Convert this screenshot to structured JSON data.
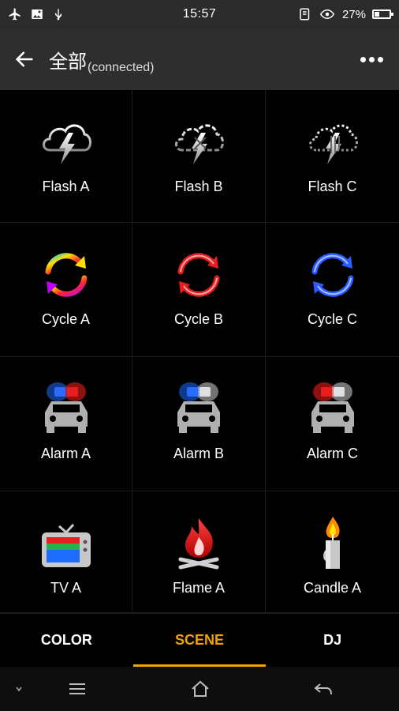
{
  "status": {
    "time": "15:57",
    "battery": "27%",
    "left_icons": [
      "airplane-icon",
      "image-icon",
      "usb-icon"
    ],
    "right_icons": [
      "nfc-icon",
      "eye-icon",
      "battery-icon"
    ]
  },
  "header": {
    "title": "全部",
    "subtitle": "(connected)"
  },
  "scenes": [
    {
      "label": "Flash A",
      "icon": "flash-a-icon"
    },
    {
      "label": "Flash B",
      "icon": "flash-b-icon"
    },
    {
      "label": "Flash C",
      "icon": "flash-c-icon"
    },
    {
      "label": "Cycle A",
      "icon": "cycle-a-icon"
    },
    {
      "label": "Cycle B",
      "icon": "cycle-b-icon"
    },
    {
      "label": "Cycle C",
      "icon": "cycle-c-icon"
    },
    {
      "label": "Alarm A",
      "icon": "alarm-a-icon"
    },
    {
      "label": "Alarm B",
      "icon": "alarm-b-icon"
    },
    {
      "label": "Alarm C",
      "icon": "alarm-c-icon"
    },
    {
      "label": "TV A",
      "icon": "tv-icon"
    },
    {
      "label": "Flame A",
      "icon": "flame-icon"
    },
    {
      "label": "Candle A",
      "icon": "candle-icon"
    }
  ],
  "tabs": [
    {
      "label": "COLOR",
      "active": false
    },
    {
      "label": "SCENE",
      "active": true
    },
    {
      "label": "DJ",
      "active": false
    }
  ],
  "colors": {
    "accent": "#f0a300",
    "appbar": "#2e2e2e",
    "background": "#000000"
  }
}
